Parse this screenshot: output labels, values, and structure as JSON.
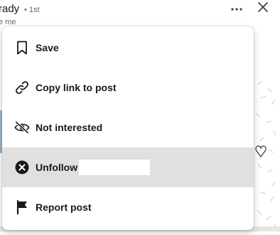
{
  "post_header": {
    "author_name": "rady",
    "degree": "• 1st",
    "author_subtitle": "e me",
    "more_icon": "ellipsis-horizontal-icon",
    "close_icon": "close-x-icon"
  },
  "menu": {
    "items": [
      {
        "label": "Save",
        "icon": "bookmark-icon"
      },
      {
        "label": "Copy link to post",
        "icon": "link-icon"
      },
      {
        "label": "Not interested",
        "icon": "eye-slash-icon"
      },
      {
        "label": "Unfollow",
        "icon": "x-circle-icon",
        "highlighted": true
      },
      {
        "label": "Report post",
        "icon": "flag-icon"
      }
    ]
  },
  "colors": {
    "text": "#191919",
    "muted": "#666666",
    "highlight": "#e0e0e0",
    "background": "#ffffff"
  }
}
